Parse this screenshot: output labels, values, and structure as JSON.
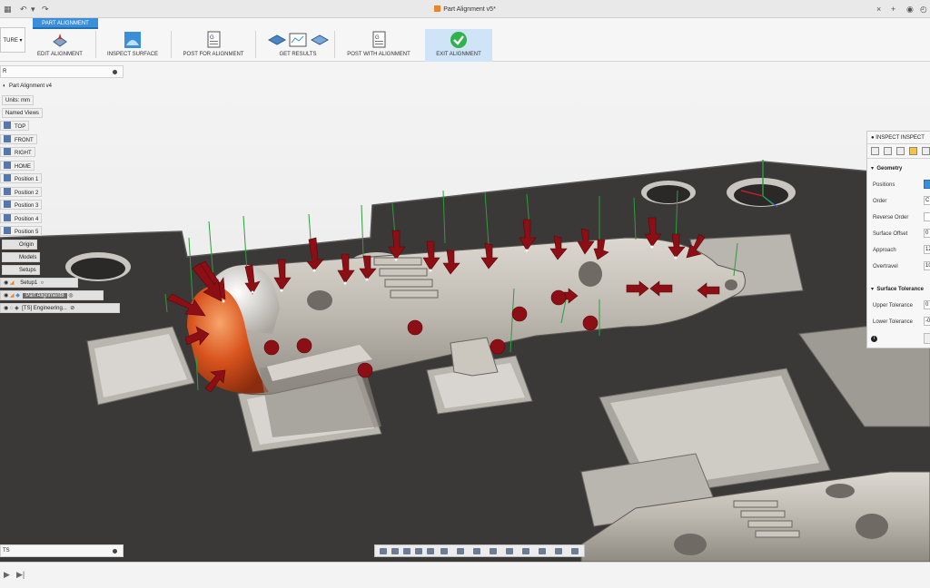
{
  "window": {
    "title": "Part Alignment v5*"
  },
  "ribbon": {
    "workspace_label": "TURE",
    "active_tab": "PART ALIGNMENT",
    "groups": [
      {
        "label": "EDIT ALIGNMENT",
        "icon": "edit-alignment-icon"
      },
      {
        "label": "INSPECT SURFACE",
        "icon": "inspect-surface-icon"
      },
      {
        "label": "POST FOR ALIGNMENT",
        "icon": "post-for-alignment-icon"
      },
      {
        "label": "GET RESULTS",
        "icon": "get-results-icon"
      },
      {
        "label": "POST WITH ALIGNMENT",
        "icon": "post-with-alignment-icon"
      },
      {
        "label": "EXIT ALIGNMENT",
        "icon": "exit-alignment-check-icon"
      }
    ]
  },
  "browser": {
    "header": "R",
    "root": "Part Alignment v4",
    "units": "Units: mm",
    "named_views": "Named Views",
    "views": [
      "TOP",
      "FRONT",
      "RIGHT",
      "HOME",
      "Position 1",
      "Position 2",
      "Position 3",
      "Position 4",
      "Position 5"
    ],
    "origin": "Origin",
    "models": "Models",
    "setups": "Setups",
    "setup1": "Setup1",
    "part_alignment": "Part Alignment8",
    "engineering": "[TS] Engineering..."
  },
  "inspect": {
    "tabs": "INSPECT   INSPECT",
    "geometry_section": "Geometry",
    "rows": [
      {
        "label": "Positions",
        "value": ""
      },
      {
        "label": "Order",
        "value": "C"
      },
      {
        "label": "Reverse Order",
        "value": ""
      },
      {
        "label": "Surface Offset",
        "value": "0"
      },
      {
        "label": "Approach",
        "value": "12"
      },
      {
        "label": "Overtravel",
        "value": "10"
      }
    ],
    "tolerance_section": "Surface Tolerance",
    "tol_rows": [
      {
        "label": "Upper Tolerance",
        "value": "0"
      },
      {
        "label": "Lower Tolerance",
        "value": "-0"
      }
    ]
  },
  "comments": {
    "label": "TS"
  },
  "colors": {
    "accent": "#3b8fd9",
    "arrow": "#8b0f14",
    "part": "#c9c4bc",
    "fixture": "#3a3836",
    "orange": "#d9541e"
  }
}
